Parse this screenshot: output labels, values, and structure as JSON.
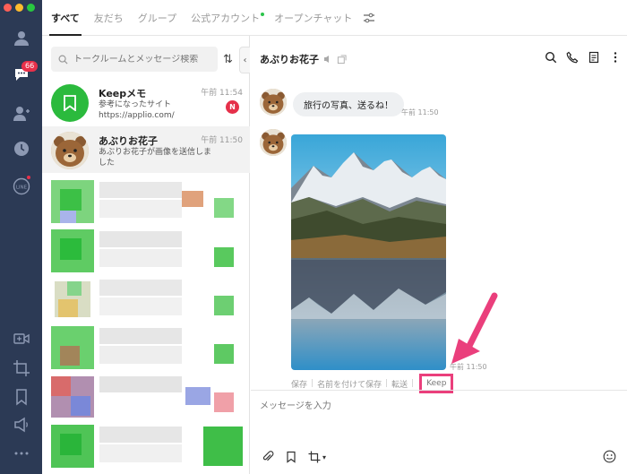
{
  "window": {
    "traffic": [
      "#ff5f57",
      "#febc2e",
      "#28c840"
    ]
  },
  "rail": {
    "chat_badge": "66",
    "line_label": "LINE"
  },
  "tabs": [
    {
      "label": "すべて"
    },
    {
      "label": "友だち"
    },
    {
      "label": "グループ"
    },
    {
      "label": "公式アカウント"
    },
    {
      "label": "オープンチャット"
    }
  ],
  "search": {
    "placeholder": "トークルームとメッセージ検索"
  },
  "chats": [
    {
      "name": "Keepメモ",
      "message": "参考になったサイト https://applio.com/",
      "time": "午前 11:54",
      "badge": "N"
    },
    {
      "name": "あぶりお花子",
      "message": "あぶりお花子が画像を送信しました",
      "time": "午前 11:50"
    }
  ],
  "conversation": {
    "title": "あぶりお花子",
    "messages": [
      {
        "text": "旅行の写真、送るね！",
        "time": "午前 11:50"
      },
      {
        "type": "image",
        "time": "午前 11:50"
      }
    ],
    "image_actions": {
      "save": "保存",
      "save_as": "名前を付けて保存",
      "forward": "転送",
      "keep": "Keep"
    },
    "composer_placeholder": "メッセージを入力"
  },
  "colors": {
    "accent_green": "#2bba3d",
    "rail_bg": "#2c3a55",
    "highlight_pink": "#ea3f7c",
    "badge_red": "#e8304a"
  }
}
